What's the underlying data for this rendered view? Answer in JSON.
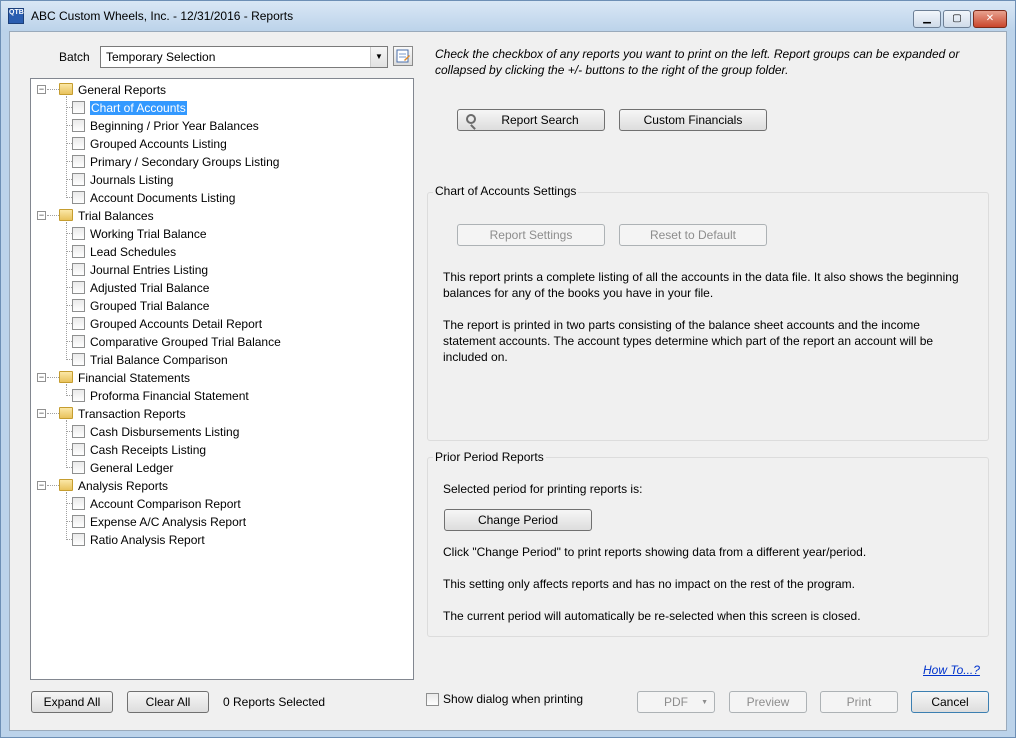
{
  "window": {
    "title": "ABC Custom Wheels, Inc. - 12/31/2016 - Reports",
    "app_icon_text": "QTB"
  },
  "batch": {
    "label": "Batch",
    "selected": "Temporary Selection"
  },
  "tree": {
    "groups": [
      {
        "label": "General Reports",
        "items": [
          "Chart of Accounts",
          "Beginning / Prior Year Balances",
          "Grouped Accounts Listing",
          "Primary / Secondary Groups Listing",
          "Journals Listing",
          "Account Documents Listing"
        ]
      },
      {
        "label": "Trial Balances",
        "items": [
          "Working Trial Balance",
          "Lead Schedules",
          "Journal Entries Listing",
          "Adjusted Trial Balance",
          "Grouped Trial Balance",
          "Grouped Accounts Detail Report",
          "Comparative Grouped Trial Balance",
          "Trial Balance Comparison"
        ]
      },
      {
        "label": "Financial Statements",
        "items": [
          "Proforma Financial Statement"
        ]
      },
      {
        "label": "Transaction Reports",
        "items": [
          "Cash Disbursements Listing",
          "Cash Receipts Listing",
          "General Ledger"
        ]
      },
      {
        "label": "Analysis Reports",
        "items": [
          "Account Comparison Report",
          "Expense A/C Analysis Report",
          "Ratio Analysis Report"
        ]
      }
    ],
    "selected_item": "Chart of Accounts"
  },
  "instructions": "Check the checkbox of any reports you want to print on the left.  Report groups can be expanded or collapsed by clicking the +/- buttons to the right of the group folder.",
  "buttons": {
    "report_search": "Report Search",
    "custom_financials": "Custom Financials",
    "report_settings": "Report Settings",
    "reset_default": "Reset to Default",
    "change_period": "Change Period",
    "expand_all": "Expand All",
    "clear_all": "Clear All",
    "pdf": "PDF",
    "preview": "Preview",
    "print": "Print",
    "cancel": "Cancel"
  },
  "settings_group": {
    "title": "Chart of Accounts Settings",
    "desc1": "This report prints a complete listing of all the accounts in the data file. It also shows the beginning balances for any of the books you have in your file.",
    "desc2": "The report is printed in two parts consisting of the balance sheet accounts and the income statement accounts. The account types determine which part of the report an account will be included on."
  },
  "prior_group": {
    "title": "Prior Period Reports",
    "selected_text": "Selected period for printing reports is:",
    "hint": "Click \"Change Period\" to print reports showing data from a different year/period.",
    "note1": "This setting only affects reports and has no impact on the rest of the program.",
    "note2": "The current period will automatically be re-selected when this screen is closed."
  },
  "footer": {
    "reports_selected": "0 Reports Selected",
    "show_dialog": "Show dialog when printing",
    "how_to": "How To...?"
  }
}
